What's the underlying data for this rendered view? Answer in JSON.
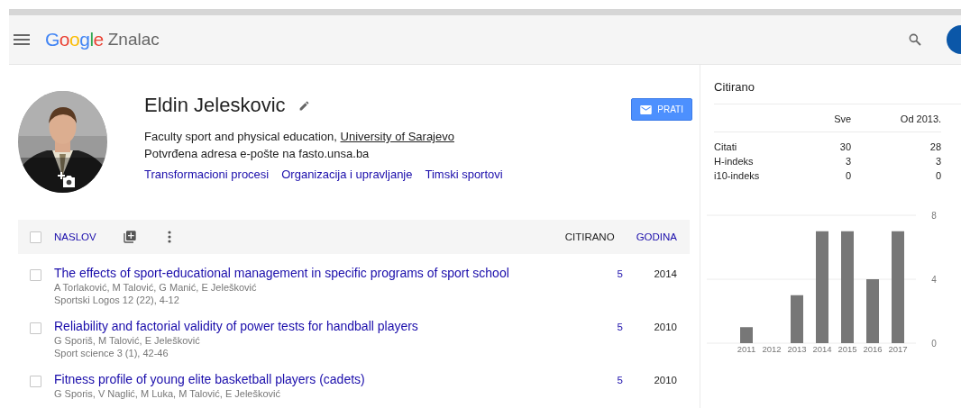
{
  "header": {
    "logo": "Google",
    "product": "Znalac"
  },
  "profile": {
    "name": "Eldin Jeleskovic",
    "affiliation": "Faculty sport and physical education, ",
    "affiliation_link": "University of Sarajevo",
    "email": "Potvrđena adresa e-pošte na fasto.unsa.ba",
    "interests": [
      "Transformacioni procesi",
      "Organizacija i upravljanje",
      "Timski sportovi"
    ],
    "follow_button": "PRATI"
  },
  "articles": {
    "select_all_checked": false,
    "columns": [
      {
        "label": "NASLOV",
        "selected": false
      },
      {
        "label": "CITIRANO",
        "selected": true
      },
      {
        "label": "GODINA",
        "selected": false
      }
    ],
    "rows": [
      {
        "title": "The effects of sport-educational management in specific programs of sport school",
        "authors": "A Torlaković, M Talović, G Manić, E Jelešković",
        "venue": "Sportski Logos 12 (22), 4-12",
        "cited": "5",
        "year": "2014",
        "checked": false
      },
      {
        "title": "Reliability and factorial validity of power tests for handball players",
        "authors": "G Sporiš, M Talović, E Jelešković",
        "venue": "Sport science 3 (1), 42-46",
        "cited": "5",
        "year": "2010",
        "checked": false
      },
      {
        "title": "Fitness profile of young elite basketball players (cadets)",
        "authors": "G Sporis, V Naglić, M Luka, M Talović, E Jelešković",
        "cited": "5",
        "year": "2010",
        "checked": false
      }
    ]
  },
  "citations": {
    "title": "Citirano",
    "columns": [
      "Sve",
      "Od 2013."
    ],
    "rows": [
      {
        "label": "Citati",
        "all": "30",
        "since": "28"
      },
      {
        "label": "H-indeks",
        "all": "3",
        "since": "3"
      },
      {
        "label": "i10-indeks",
        "all": "0",
        "since": "0"
      }
    ],
    "chart_data": {
      "type": "bar",
      "categories": [
        "2011",
        "2012",
        "2013",
        "2014",
        "2015",
        "2016",
        "2017"
      ],
      "values": [
        1,
        0,
        3,
        7,
        7,
        4,
        7
      ],
      "ylim": [
        0,
        8
      ],
      "yticks": [
        0,
        4,
        8
      ]
    }
  }
}
